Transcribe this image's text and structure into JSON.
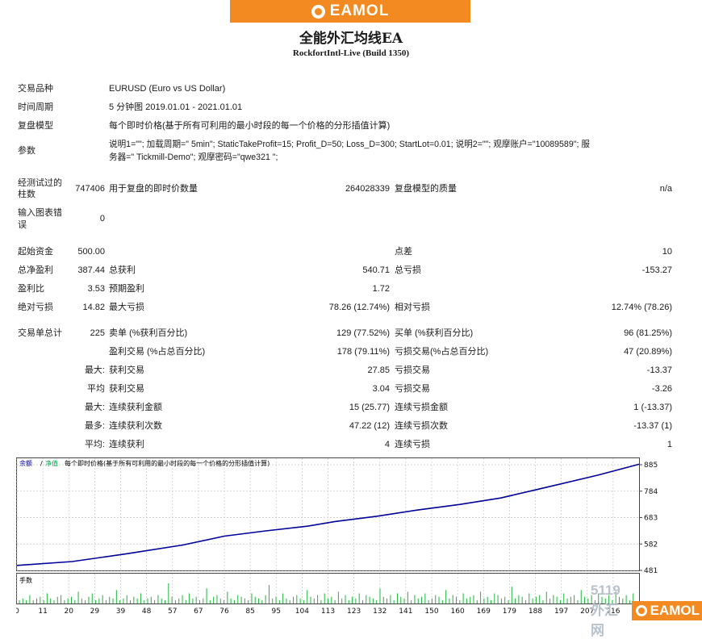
{
  "banner": {
    "brand": "EAMOL"
  },
  "header": {
    "title": "全能外汇均线EA",
    "subtitle": "RockfortIntl-Live (Build 1350)"
  },
  "info": {
    "symbol_label": "交易品种",
    "symbol_value": "EURUSD (Euro vs US Dollar)",
    "period_label": "时间周期",
    "period_value": "5 分钟图 2019.01.01 - 2021.01.01",
    "model_label": "复盘模型",
    "model_value": "每个即时价格(基于所有可利用的最小时段的每一个价格的分形插值计算)",
    "params_label": "参数",
    "params_line1": "说明1=\"\"; 加载周期=\" 5min\"; StaticTakeProfit=15; Profit_D=50; Loss_D=300; StartLot=0.01; 说明2=\"\"; 观摩账户=\"10089589\"; 服",
    "params_line2": "务器=\" Tickmill-Demo\"; 观摩密码=\"qwe321 \";"
  },
  "bars": {
    "tested_label1": "经测试过的",
    "tested_label2": "柱数",
    "tested_value": "747406",
    "ticks_label": "用于复盘的即时价数量",
    "ticks_value": "264028339",
    "quality_label": "复盘模型的质量",
    "quality_value": "n/a",
    "errors_label1": "输入图表错",
    "errors_label2": "误",
    "errors_value": "0"
  },
  "stats": {
    "deposit_label": "起始资金",
    "deposit_value": "500.00",
    "spread_label": "点差",
    "spread_value": "10",
    "net_label": "总净盈利",
    "net_value": "387.44",
    "gross_profit_label": "总获利",
    "gross_profit_value": "540.71",
    "gross_loss_label": "总亏损",
    "gross_loss_value": "-153.27",
    "pf_label": "盈利比",
    "pf_value": "3.53",
    "expected_label": "预期盈利",
    "expected_value": "1.72",
    "abs_dd_label": "绝对亏损",
    "abs_dd_value": "14.82",
    "max_dd_label": "最大亏损",
    "max_dd_value": "78.26 (12.74%)",
    "rel_dd_label": "相对亏损",
    "rel_dd_value": "12.74% (78.26)"
  },
  "trades": {
    "total_label": "交易单总计",
    "total_value": "225",
    "short_label": "卖单 (%获利百分比)",
    "short_value": "129 (77.52%)",
    "long_label": "买单 (%获利百分比)",
    "long_value": "96 (81.25%)",
    "win_label": "盈利交易 (%占总百分比)",
    "win_value": "178 (79.11%)",
    "loss_label": "亏损交易(%占总百分比)",
    "loss_value": "47 (20.89%)",
    "max_prefix": "最大:",
    "largest_win_label": "获利交易",
    "largest_win_value": "27.85",
    "largest_loss_label": "亏损交易",
    "largest_loss_value": "-13.37",
    "avg_prefix": "平均",
    "avg_win_label": "获利交易",
    "avg_win_value": "3.04",
    "avg_loss_label": "亏损交易",
    "avg_loss_value": "-3.26",
    "max2_prefix": "最大:",
    "cons_win_amt_label": "连续获利金额",
    "cons_win_amt_value": "15 (25.77)",
    "cons_loss_amt_label": "连续亏损金额",
    "cons_loss_amt_value": "1 (-13.37)",
    "most_prefix": "最多:",
    "cons_win_cnt_label": "连续获利次数",
    "cons_win_cnt_value": "47.22 (12)",
    "cons_loss_cnt_label": "连续亏损次数",
    "cons_loss_cnt_value": "-13.37 (1)",
    "avg2_prefix": "平均:",
    "avg_cons_win_label": "连续获利",
    "avg_cons_win_value": "4",
    "avg_cons_loss_label": "连续亏损",
    "avg_cons_loss_value": "1"
  },
  "chart_data": {
    "type": "line",
    "legend": {
      "balance": "余额",
      "sep": "/",
      "equity": "净值",
      "model": "每个即时价格(基于所有可利用的最小时段的每一个价格的分形插值计算)"
    },
    "y_ticks": [
      "885",
      "784",
      "683",
      "582",
      "481"
    ],
    "y_range": [
      481,
      885
    ],
    "x_ticks": [
      "0",
      "11",
      "20",
      "29",
      "39",
      "48",
      "57",
      "67",
      "76",
      "85",
      "95",
      "104",
      "113",
      "123",
      "132",
      "141",
      "150",
      "160",
      "169",
      "179",
      "188",
      "197",
      "207",
      "216"
    ],
    "x_range": [
      0,
      225
    ],
    "series": [
      {
        "name": "余额",
        "color": "#000099",
        "points": [
          [
            0,
            500
          ],
          [
            20,
            515
          ],
          [
            40,
            545
          ],
          [
            60,
            578
          ],
          [
            75,
            612
          ],
          [
            90,
            632
          ],
          [
            105,
            650
          ],
          [
            115,
            668
          ],
          [
            130,
            688
          ],
          [
            145,
            712
          ],
          [
            160,
            733
          ],
          [
            175,
            758
          ],
          [
            190,
            795
          ],
          [
            210,
            845
          ],
          [
            225,
            887
          ]
        ]
      },
      {
        "name": "净值",
        "color": "#00a84f",
        "points": []
      }
    ],
    "volume_label": "手数",
    "volume": [
      0.02,
      0.03,
      0.02,
      0.05,
      0.02,
      0.03,
      0.04,
      0.02,
      0.06,
      0.03,
      0.02,
      0.04,
      0.05,
      0.02,
      0.03,
      0.04,
      0.02,
      0.07,
      0.03,
      0.02,
      0.04,
      0.06,
      0.02,
      0.03,
      0.05,
      0.02,
      0.04,
      0.03,
      0.08,
      0.02,
      0.03,
      0.05,
      0.02,
      0.04,
      0.03,
      0.06,
      0.02,
      0.03,
      0.04,
      0.02,
      0.05,
      0.03,
      0.02,
      0.12,
      0.04,
      0.02,
      0.03,
      0.05,
      0.02,
      0.06,
      0.03,
      0.04,
      0.02,
      0.03,
      0.09,
      0.02,
      0.04,
      0.05,
      0.03,
      0.02,
      0.07,
      0.03,
      0.02,
      0.05,
      0.04,
      0.03,
      0.02,
      0.06,
      0.04,
      0.03,
      0.02,
      0.05,
      0.11,
      0.03,
      0.04,
      0.02,
      0.06,
      0.03,
      0.02,
      0.04,
      0.05,
      0.03,
      0.02,
      0.08,
      0.04,
      0.03,
      0.05,
      0.02,
      0.06,
      0.03,
      0.04,
      0.02,
      0.07,
      0.03,
      0.05,
      0.02,
      0.04,
      0.03,
      0.06,
      0.02,
      0.05,
      0.04,
      0.03,
      0.02,
      0.09,
      0.04,
      0.03,
      0.05,
      0.02,
      0.06,
      0.04,
      0.03,
      0.07,
      0.02,
      0.05,
      0.03,
      0.04,
      0.06,
      0.02,
      0.03,
      0.05,
      0.04,
      0.02,
      0.08,
      0.03,
      0.05,
      0.04,
      0.02,
      0.06,
      0.03,
      0.04,
      0.05,
      0.02,
      0.07,
      0.03,
      0.04,
      0.02,
      0.06,
      0.05,
      0.03,
      0.04,
      0.02,
      0.1,
      0.03,
      0.05,
      0.04,
      0.02,
      0.06,
      0.03,
      0.04,
      0.05,
      0.02,
      0.07,
      0.03,
      0.05,
      0.04,
      0.02,
      0.06,
      0.03,
      0.04,
      0.05,
      0.02,
      0.08,
      0.04,
      0.03,
      0.05,
      0.02,
      0.06,
      0.04,
      0.03,
      0.05,
      0.02,
      0.07,
      0.04,
      0.03,
      0.05,
      0.02,
      0.06
    ]
  },
  "watermark": {
    "text": "5119外汇网",
    "brand": "EAMOL"
  }
}
